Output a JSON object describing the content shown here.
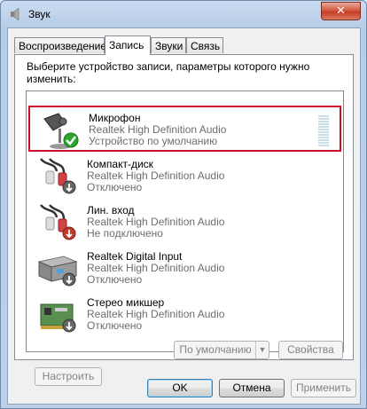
{
  "window": {
    "title": "Звук",
    "close_label": "✕"
  },
  "tabs": [
    {
      "label": "Воспроизведение",
      "active": false
    },
    {
      "label": "Запись",
      "active": true
    },
    {
      "label": "Звуки",
      "active": false
    },
    {
      "label": "Связь",
      "active": false
    }
  ],
  "instruction": "Выберите устройство записи, параметры которого нужно изменить:",
  "devices": [
    {
      "name": "Микрофон",
      "driver": "Realtek High Definition Audio",
      "status": "Устройство по умолчанию",
      "icon": "microphone-icon",
      "badge": "default-check-icon",
      "selected": true,
      "level": 0
    },
    {
      "name": "Компакт-диск",
      "driver": "Realtek High Definition Audio",
      "status": "Отключено",
      "icon": "rca-cable-icon",
      "badge": "disabled-arrow-icon",
      "selected": false
    },
    {
      "name": "Лин. вход",
      "driver": "Realtek High Definition Audio",
      "status": "Не подключено",
      "icon": "rca-cable-icon",
      "badge": "unplugged-arrow-icon",
      "selected": false
    },
    {
      "name": "Realtek Digital Input",
      "driver": "Realtek High Definition Audio",
      "status": "Отключено",
      "icon": "digital-input-icon",
      "badge": "disabled-arrow-icon",
      "selected": false
    },
    {
      "name": "Стерео микшер",
      "driver": "Realtek High Definition Audio",
      "status": "Отключено",
      "icon": "sound-card-icon",
      "badge": "disabled-arrow-icon",
      "selected": false
    }
  ],
  "buttons": {
    "configure": "Настроить",
    "set_default": "По умолчанию",
    "properties": "Свойства",
    "ok": "OK",
    "cancel": "Отмена",
    "apply": "Применить"
  },
  "colors": {
    "selection_border": "#c8102e",
    "check_green": "#2fa52f",
    "badge_red": "#c0392b"
  }
}
